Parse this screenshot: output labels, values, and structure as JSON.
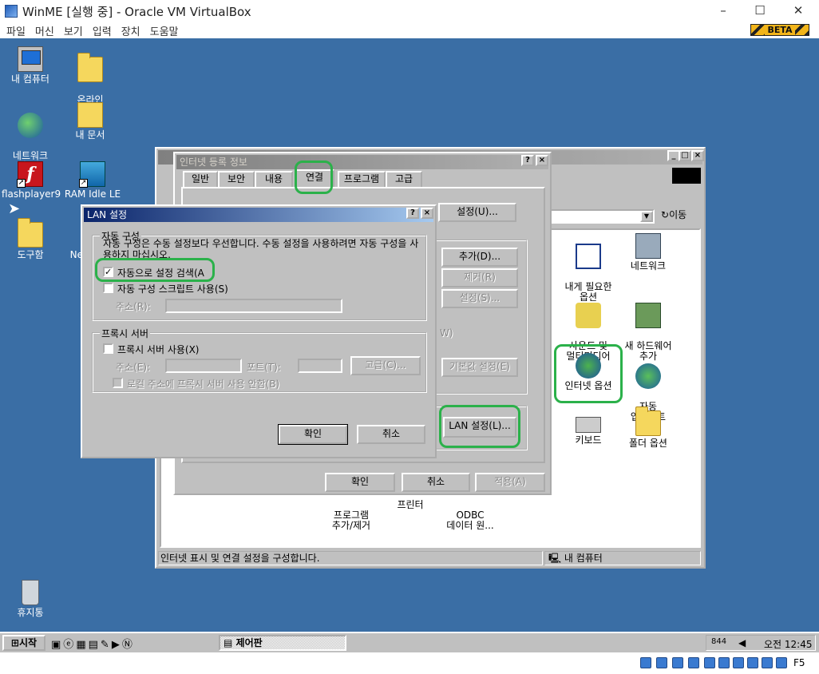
{
  "host": {
    "title": "WinME [실행 중] - Oracle VM VirtualBox",
    "menu": [
      "파일",
      "머신",
      "보기",
      "입력",
      "장치",
      "도움말"
    ],
    "badge": "BETA",
    "status_right": "F5"
  },
  "desktop": {
    "icons": [
      {
        "label": "내 컴퓨터",
        "icon": "my-computer-icon"
      },
      {
        "label": "온라인\n서비스",
        "icon": "folder-icon"
      },
      {
        "label": "네트워크\n환경",
        "icon": "network-neighborhood-icon"
      },
      {
        "label": "내 문서",
        "icon": "my-documents-icon"
      },
      {
        "label": "flashplayer9",
        "icon": "flash-icon"
      },
      {
        "label": "RAM Idle LE",
        "icon": "ram-idle-icon"
      },
      {
        "label": "도구함",
        "icon": "folder-icon"
      },
      {
        "label": "Ne",
        "icon": "app-icon"
      },
      {
        "label": "휴지통",
        "icon": "recycle-bin-icon"
      }
    ]
  },
  "control_panel": {
    "title": "제어판",
    "nav_go": "이동",
    "status_text": "인터넷 표시 및 연결 설정을 구성합니다.",
    "status_location": "내 컴퓨터",
    "icons": [
      {
        "label": "내게 필요한\n옵션",
        "icon": "accessibility-icon"
      },
      {
        "label": "네트워크",
        "icon": "network-icon"
      },
      {
        "label": "사운드 및\n멀티미디어",
        "icon": "speaker-icon"
      },
      {
        "label": "새 하드웨어\n추가",
        "icon": "add-hardware-icon"
      },
      {
        "label": "인터넷 옵션",
        "icon": "internet-options-icon"
      },
      {
        "label": "자동\n업데이트",
        "icon": "auto-update-icon"
      },
      {
        "label": "키보드",
        "icon": "keyboard-icon"
      },
      {
        "label": "폴더 옵션",
        "icon": "folder-options-icon"
      },
      {
        "label": "프로그램\n추가/제거",
        "icon": "add-remove-icon"
      },
      {
        "label": "프린터",
        "icon": "printer-icon"
      },
      {
        "label": "ODBC\n데이터 원...",
        "icon": "odbc-icon"
      }
    ]
  },
  "inet": {
    "title": "인터넷 등록 정보",
    "tabs": [
      "일반",
      "보안",
      "내용",
      "연결",
      "프로그램",
      "고급"
    ],
    "active_tab": "연결",
    "buttons": {
      "setup": "설정(U)...",
      "add": "추가(D)...",
      "remove": "제거(R)",
      "settings": "설정(S)...",
      "default": "기본값 설정(E)",
      "lan": "LAN 설정(L)...",
      "ok": "확인",
      "cancel": "취소",
      "apply": "적용(A)"
    },
    "partial_label": "W)"
  },
  "lan": {
    "title": "LAN 설정",
    "auto_group": "자동 구성",
    "auto_desc": "자동 구성은 수동 설정보다 우선합니다. 수동 설정을 사용하려면 자동 구성을 사용하지 마십시오.",
    "auto_detect": "자동으로 설정 검색(A",
    "auto_script": "자동 구성 스크립트 사용(S)",
    "address_label": "주소(R):",
    "proxy_group": "프록시 서버",
    "proxy_use": "프록시 서버 사용(X)",
    "proxy_address": "주소(E):",
    "proxy_port": "포트(T):",
    "advanced": "고급(C)...",
    "bypass_local": "로컬 주소에 프록시 서버 사용 안함(B)",
    "ok": "확인",
    "cancel": "취소"
  },
  "taskbar": {
    "start": "시작",
    "task": "제어판",
    "tray_text": "844",
    "clock": "오전 12:45"
  }
}
